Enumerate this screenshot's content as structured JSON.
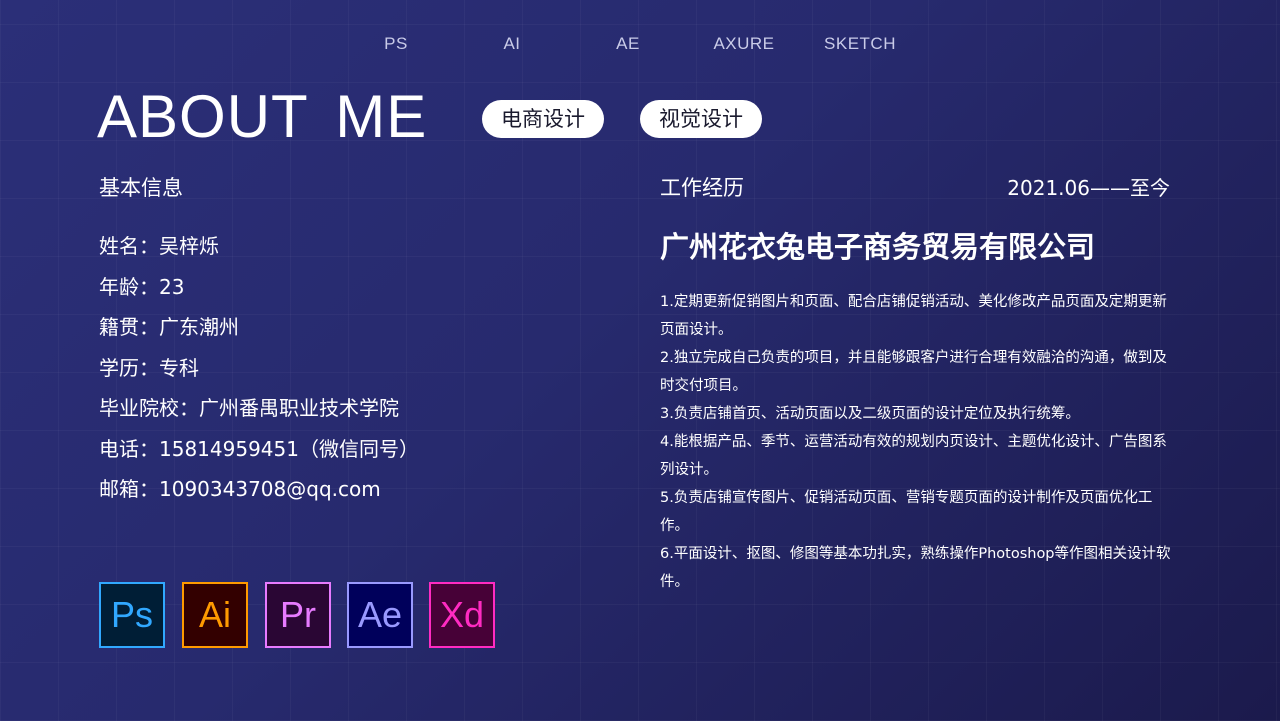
{
  "nav": [
    "PS",
    "AI",
    "AE",
    "AXURE",
    "SKETCH"
  ],
  "title": "ABOUT  ME",
  "tags": [
    "电商设计",
    "视觉设计"
  ],
  "basic_info": {
    "heading": "基本信息",
    "items": [
      "姓名：吴梓烁",
      "年龄：23",
      "籍贯：广东潮州",
      "学历：专科",
      "毕业院校：广州番禺职业技术学院",
      "电话：15814959451（微信同号）",
      "邮箱：1090343708@qq.com"
    ]
  },
  "work": {
    "heading": "工作经历",
    "date": "2021.06——至今",
    "company": "广州花衣兔电子商务贸易有限公司",
    "duties": [
      "1.定期更新促销图片和页面、配合店铺促销活动、美化修改产品页面及定期更新页面设计。",
      "2.独立完成自己负责的项目，并且能够跟客户进行合理有效融洽的沟通，做到及时交付项目。",
      "3.负责店铺首页、活动页面以及二级页面的设计定位及执行统筹。",
      "4.能根据产品、季节、运营活动有效的规划内页设计、主题优化设计、广告图系列设计。",
      "5.负责店铺宣传图片、促销活动页面、营销专题页面的设计制作及页面优化工作。",
      "6.平面设计、抠图、修图等基本功扎实，熟练操作Photoshop等作图相关设计软件。"
    ]
  },
  "software_icons": [
    {
      "label": "Ps",
      "color": "#31a8ff",
      "bg": "#001e36",
      "icon": "photoshop-icon"
    },
    {
      "label": "Ai",
      "color": "#ff9a00",
      "bg": "#330000",
      "icon": "illustrator-icon"
    },
    {
      "label": "Pr",
      "color": "#e77bff",
      "bg": "#2a0634",
      "icon": "premiere-icon"
    },
    {
      "label": "Ae",
      "color": "#9999ff",
      "bg": "#00005b",
      "icon": "aftereffects-icon"
    },
    {
      "label": "Xd",
      "color": "#ff2bc2",
      "bg": "#470137",
      "icon": "xd-icon"
    }
  ]
}
